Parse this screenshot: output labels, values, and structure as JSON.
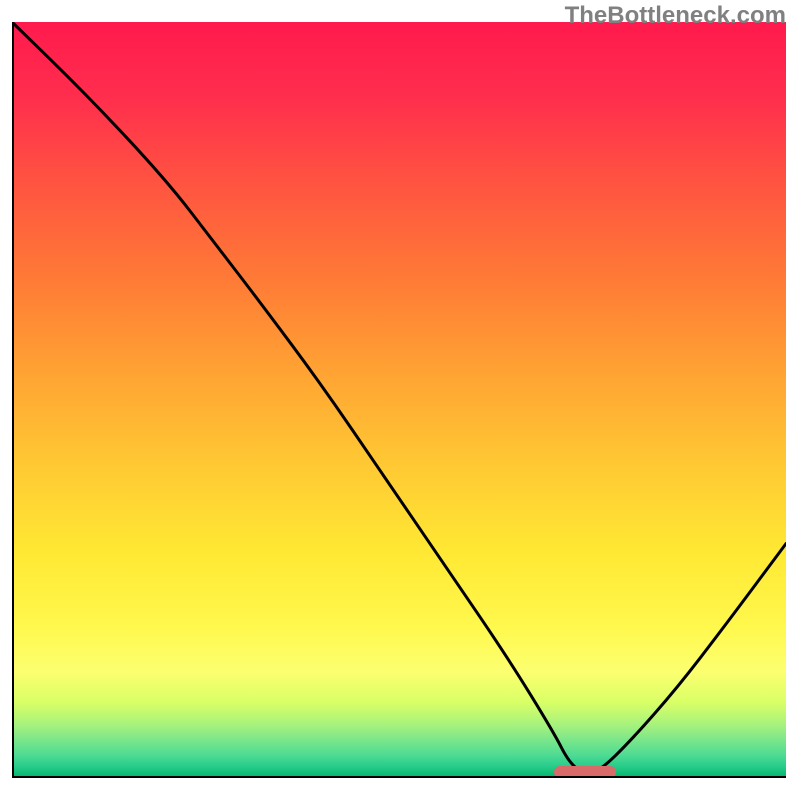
{
  "watermark": "TheBottleneck.com",
  "chart_data": {
    "type": "line",
    "title": "",
    "xlabel": "",
    "ylabel": "",
    "xlim": [
      0,
      100
    ],
    "ylim": [
      0,
      100
    ],
    "series": [
      {
        "name": "bottleneck-curve",
        "x": [
          0,
          10,
          20,
          26,
          32,
          40,
          48,
          56,
          64,
          70,
          72,
          74,
          76,
          80,
          86,
          92,
          100
        ],
        "y": [
          100,
          90,
          79,
          71,
          63,
          52,
          40,
          28,
          16,
          6,
          2,
          0.5,
          1,
          5,
          12,
          20,
          31
        ]
      }
    ],
    "optimal_range": {
      "start": 70,
      "end": 78,
      "color": "#d86a6a"
    },
    "gradient_colors": {
      "top": "#ff1a4d",
      "middle": "#ffe833",
      "bottom": "#00b366"
    },
    "annotations": []
  }
}
